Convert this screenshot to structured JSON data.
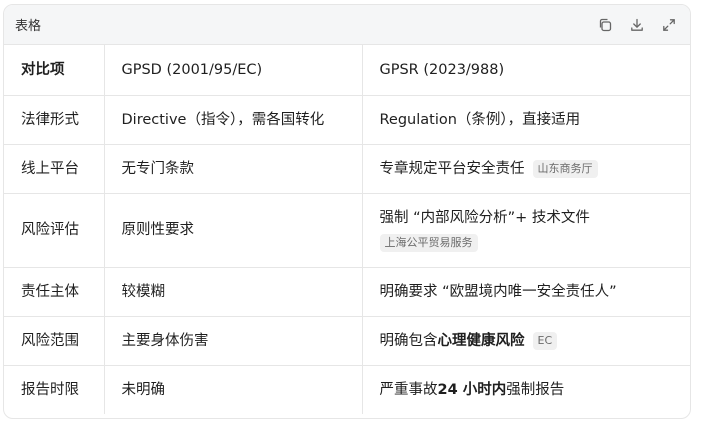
{
  "toolbar": {
    "title": "表格",
    "icons": [
      "copy-icon",
      "download-icon",
      "expand-icon"
    ]
  },
  "table": {
    "header": [
      "对比项",
      "GPSD (2001/95/EC)",
      "GPSR (2023/988)"
    ],
    "rows": [
      {
        "item": "法律形式",
        "gpsd": "Directive（指令），需各国转化",
        "gpsr": "Regulation（条例），直接适用"
      },
      {
        "item": "线上平台",
        "gpsd": "无专门条款",
        "gpsr": "专章规定平台安全责任",
        "gpsr_tag": "山东商务厅"
      },
      {
        "item": "风险评估",
        "gpsd": "原则性要求",
        "gpsr": "强制 “内部风险分析”+ 技术文件",
        "gpsr_tag": "上海公平贸易服务"
      },
      {
        "item": "责任主体",
        "gpsd": "较模糊",
        "gpsr": "明确要求 “欧盟境内唯一安全责任人”"
      },
      {
        "item": "风险范围",
        "gpsd": "主要身体伤害",
        "gpsr_pre": "明确包含",
        "gpsr_bold": "心理健康风险",
        "gpsr_tag": "EC"
      },
      {
        "item": "报告时限",
        "gpsd": "未明确",
        "gpsr_pre": "严重事故",
        "gpsr_bold": "24 小时内",
        "gpsr_post": "强制报告"
      }
    ]
  }
}
